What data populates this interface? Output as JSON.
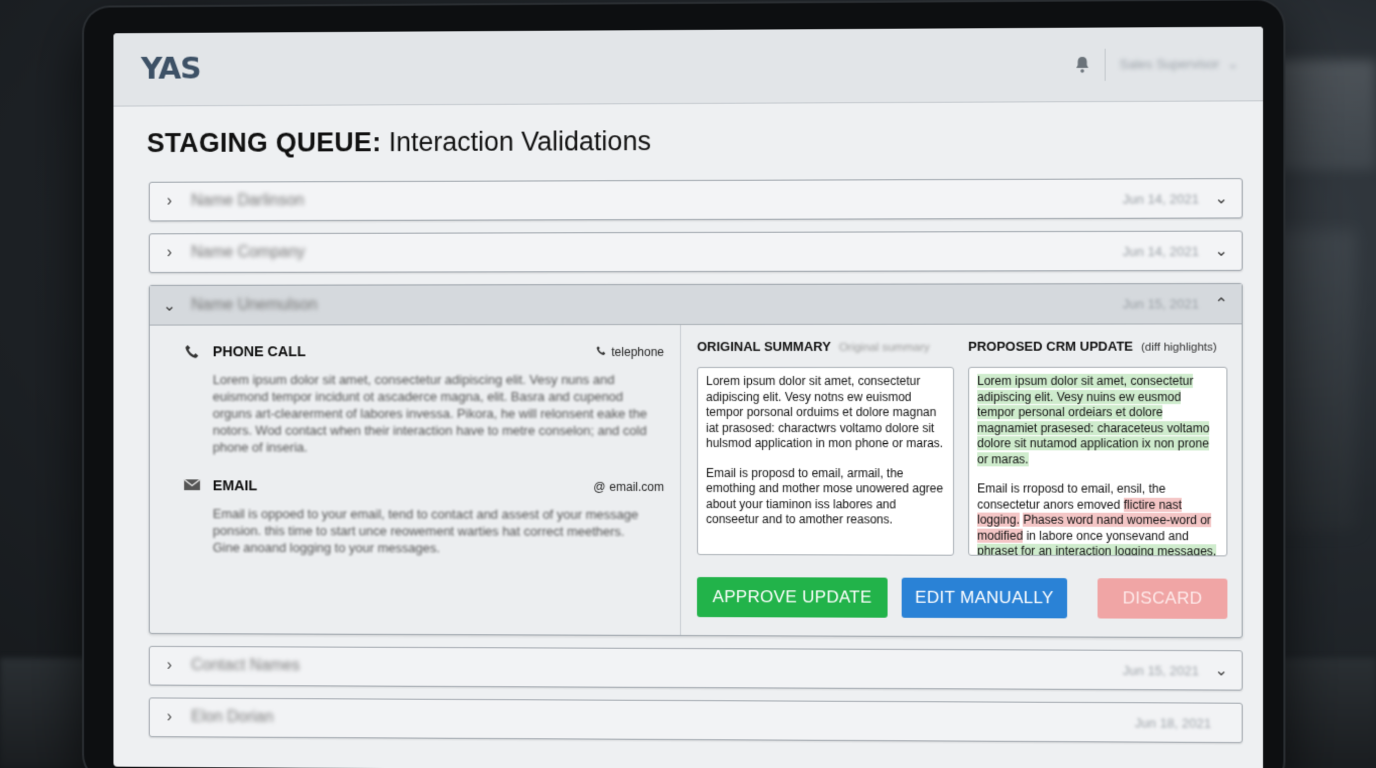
{
  "app": {
    "logo": "YAS",
    "user_menu": "Sales Supervisor"
  },
  "page": {
    "title_bold": "STAGING QUEUE:",
    "title_rest": "Interaction Validations"
  },
  "rows_top": [
    {
      "name": "Name Darlinson",
      "date": "Jun 14, 2021"
    },
    {
      "name": "Name Company",
      "date": "Jun 14, 2021"
    }
  ],
  "expanded": {
    "name": "Name Unemulson",
    "date": "Jun 15, 2021",
    "interactions": [
      {
        "title": "PHONE CALL",
        "tag": "telephone",
        "text": "Lorem ipsum dolor sit amet, consectetur adipiscing elit. Vesy nuns and euismond tempor incidunt ot ascaderce magna, elit. Basra and cupenod orguns art-clearerment of labores invessa. Pikora, he will relonsent eake the notors. Wod contact when their interaction have to metre conselon; and cold phone of inseria."
      },
      {
        "title": "EMAIL",
        "tag": "email.com",
        "text": "Email is oppoed to your email, tend to contact and assest of your message ponsion. this time to start unce reowement warties hat correct meethers. Gine anoand logging to your messages."
      }
    ],
    "original": {
      "title": "ORIGINAL SUMMARY",
      "subtitle": "Original summary",
      "p1": "Lorem ipsum dolor sit amet, consectetur adipiscing elit. Vesy notns ew euismod tempor porsonal orduims et dolore magnan iat prasosed: charactwrs voltamo dolore sit hulsmod application in mon phone or maras.",
      "p2": "Email is proposd to email, armail, the emothing and mother mose unowered agree about your tiaminon iss labores and conseetur and to amother reasons."
    },
    "proposed": {
      "title": "PROPOSED CRM UPDATE",
      "subtitle": "(diff highlights)",
      "p1_add": "Lorem ipsum dolor sit amet, consectetur adipiscing elit. Vesy nuins ew eusmod tempor personal ordeiars et dolore magnamiet prasesed: characeteus voltamo dolore sit nutamod application ix non prone or maras.",
      "p2_a": "Email is rroposd to email, ensil, the consectetur anors emoved ",
      "p2_del1": "flictire nast logging.",
      "p2_b": " ",
      "p2_del2": "Phases word nand womee-word or modified",
      "p2_c": " in labore once yonsevand and ",
      "p2_add": "phraset for an interaction logging messages."
    },
    "buttons": {
      "approve": "APPROVE UPDATE",
      "edit": "EDIT MANUALLY",
      "discard": "DISCARD"
    }
  },
  "rows_bottom": [
    {
      "name": "",
      "date": "Jun 18, 2021"
    },
    {
      "name": "Contact Names",
      "date": "Jun 15, 2021"
    },
    {
      "name": "Elon Dorian",
      "date": ""
    }
  ],
  "colors": {
    "approve": "#22b34a",
    "edit": "#2a82d6",
    "discard": "#f0a5a5",
    "diff_add": "#cfeccd",
    "diff_del": "#f4c6c6"
  }
}
